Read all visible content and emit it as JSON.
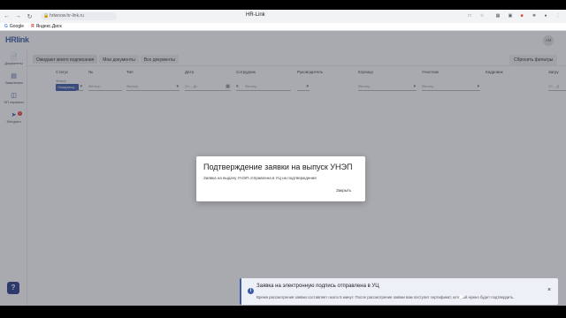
{
  "browser": {
    "url": "hrlwoow.hr-link.ru",
    "window_title": "HR-Link",
    "bookmarks": [
      "Google",
      "Яндекс.Диск"
    ]
  },
  "app": {
    "logo": "HRlink",
    "user_initials": "АМ"
  },
  "sidebar": {
    "items": [
      {
        "label": "Документы",
        "icon": "documents-icon",
        "active": true
      },
      {
        "label": "Заявления",
        "icon": "applications-icon"
      },
      {
        "label": "ЭП сервисы",
        "icon": "ep-services-icon"
      },
      {
        "label": "Telegram",
        "icon": "telegram-icon",
        "badge": "1"
      }
    ],
    "help_label": "?"
  },
  "tabs": [
    {
      "label": "Ожидают моего подписания",
      "active": true
    },
    {
      "label": "Мои документы"
    },
    {
      "label": "Все документы"
    }
  ],
  "reset_filters_label": "Сбросить фильтры",
  "table": {
    "columns": [
      "Статус",
      "№",
      "Тип",
      "Дата",
      "Сотрудник",
      "Руководитель",
      "Юрлицо",
      "Участник",
      "Кадровик",
      "Загру"
    ],
    "status_filter_label": "Фильтр",
    "status_chip": "Ожидающ...",
    "filters": {
      "number": "Фильтр",
      "type": "Фильтр",
      "date_from": "От",
      "date_to": "До",
      "employee": "Фильтр",
      "legal": "Фильтр",
      "participant": "Фильтр",
      "upload": "От – Д"
    }
  },
  "modal": {
    "title": "Подтверждение заявки на выпуск УНЭП",
    "text": "Заявка на выдачу УНЭП отправлена в УЦ на подтверждение",
    "close_label": "Закрыть"
  },
  "toast": {
    "title": "Заявка на электронную подпись отправлена в УЦ",
    "text": "Время рассмотрения заявки составляет около 5 минут. После рассмотрения заявки вам поступит сертификат, который нужно будет подтвердить.",
    "icon": "info-icon",
    "close": "×"
  },
  "colors": {
    "accent": "#3d5ca8",
    "overlay": "#323440"
  }
}
